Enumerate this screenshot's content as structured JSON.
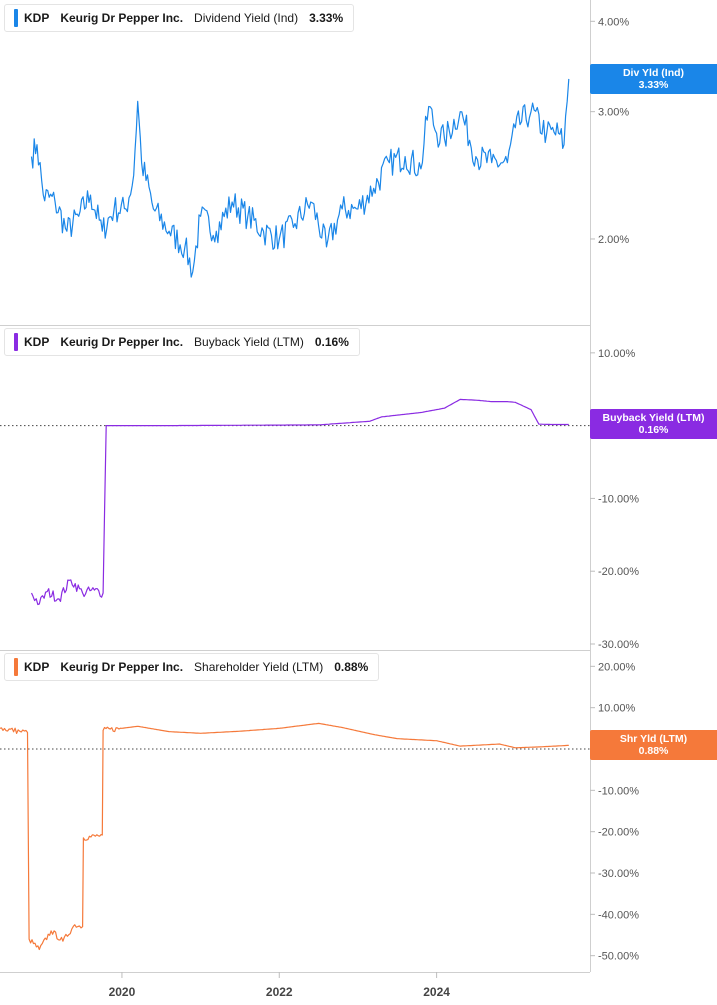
{
  "chart_data": [
    {
      "type": "line",
      "ticker": "KDP",
      "company": "Keurig Dr Pepper Inc.",
      "metric": "Dividend Yield (Ind)",
      "last_value": "3.33%",
      "tag": {
        "label": "Div Yld (Ind)",
        "value": "3.33%"
      },
      "color": "#1a86e8",
      "scale": "log",
      "ylim": [
        1.55,
        4.2
      ],
      "yticks": [
        {
          "value": 2.0,
          "label": "2.00%"
        },
        {
          "value": 3.0,
          "label": "3.00%"
        },
        {
          "value": 4.0,
          "label": "4.00%"
        }
      ],
      "series": [
        {
          "x": [
            2018.85,
            2018.92,
            2019.0,
            2019.15,
            2019.3,
            2019.45,
            2019.6,
            2019.75,
            2019.9,
            2020.05,
            2020.15,
            2020.2,
            2020.25,
            2020.4,
            2020.6,
            2020.8,
            2020.9,
            2021.0,
            2021.2,
            2021.4,
            2021.6,
            2021.8,
            2022.0,
            2022.2,
            2022.4,
            2022.6,
            2022.8,
            2023.0,
            2023.2,
            2023.4,
            2023.6,
            2023.8,
            2023.9,
            2024.0,
            2024.1,
            2024.3,
            2024.5,
            2024.7,
            2024.9,
            2025.0,
            2025.2,
            2025.4,
            2025.55,
            2025.62,
            2025.68
          ],
          "values": [
            2.6,
            2.7,
            2.3,
            2.25,
            2.05,
            2.15,
            2.3,
            2.05,
            2.2,
            2.2,
            2.45,
            3.1,
            2.55,
            2.2,
            2.05,
            1.95,
            1.8,
            2.15,
            2.05,
            2.25,
            2.15,
            2.05,
            2.0,
            2.1,
            2.25,
            1.95,
            2.2,
            2.2,
            2.35,
            2.55,
            2.6,
            2.5,
            3.05,
            2.8,
            2.75,
            3.0,
            2.6,
            2.55,
            2.55,
            2.85,
            3.0,
            2.8,
            2.8,
            2.7,
            3.33
          ]
        }
      ]
    },
    {
      "type": "line",
      "ticker": "KDP",
      "company": "Keurig Dr Pepper Inc.",
      "metric": "Buyback Yield (LTM)",
      "last_value": "0.16%",
      "tag": {
        "label": "Buyback Yield (LTM)",
        "value": "0.16%"
      },
      "color": "#8a2be2",
      "reference_line": 0,
      "ylim": [
        -30,
        13
      ],
      "yticks": [
        {
          "value": 10,
          "label": "10.00%"
        },
        {
          "value": 0,
          "label": "0.00%"
        },
        {
          "value": -10,
          "label": "-10.00%"
        },
        {
          "value": -20,
          "label": "-20.00%"
        },
        {
          "value": -30,
          "label": "-30.00%"
        }
      ],
      "series": [
        {
          "x": [
            2018.85,
            2018.95,
            2019.05,
            2019.2,
            2019.35,
            2019.5,
            2019.65,
            2019.76,
            2019.8,
            2020.5,
            2021.5,
            2022.5,
            2023.15,
            2023.3,
            2023.8,
            2024.1,
            2024.3,
            2024.5,
            2024.7,
            2024.9,
            2025.0,
            2025.2,
            2025.3,
            2025.45,
            2025.68
          ],
          "values": [
            -23.0,
            -24.5,
            -22.8,
            -23.8,
            -21.2,
            -23.0,
            -22.6,
            -23.0,
            0.0,
            0.0,
            0.05,
            0.1,
            0.6,
            1.2,
            1.8,
            2.4,
            3.6,
            3.5,
            3.3,
            3.3,
            3.2,
            2.2,
            0.2,
            0.16,
            0.16
          ]
        }
      ]
    },
    {
      "type": "line",
      "ticker": "KDP",
      "company": "Keurig Dr Pepper Inc.",
      "metric": "Shareholder Yield (LTM)",
      "last_value": "0.88%",
      "tag": {
        "label": "Shr Yld (LTM)",
        "value": "0.88%"
      },
      "color": "#f5793a",
      "reference_line": 0,
      "ylim": [
        -52.5,
        22.5
      ],
      "yticks": [
        {
          "value": 20,
          "label": "20.00%"
        },
        {
          "value": 10,
          "label": "10.00%"
        },
        {
          "value": 0,
          "label": "0.00%"
        },
        {
          "value": -10,
          "label": "-10.00%"
        },
        {
          "value": -20,
          "label": "-20.00%"
        },
        {
          "value": -30,
          "label": "-30.00%"
        },
        {
          "value": -40,
          "label": "-40.00%"
        },
        {
          "value": -50,
          "label": "-50.00%"
        }
      ],
      "series": [
        {
          "x": [
            2018.45,
            2018.7,
            2018.8,
            2018.82,
            2018.95,
            2019.1,
            2019.25,
            2019.4,
            2019.5,
            2019.51,
            2019.7,
            2019.75,
            2019.76,
            2020.0,
            2020.2,
            2020.6,
            2021.0,
            2021.5,
            2022.0,
            2022.5,
            2022.8,
            2023.2,
            2023.5,
            2024.0,
            2024.3,
            2024.8,
            2025.0,
            2025.3,
            2025.68
          ],
          "values": [
            5.0,
            4.3,
            4.0,
            -46.0,
            -48.5,
            -44.0,
            -46.5,
            -42.5,
            -43.0,
            -21.5,
            -21.0,
            -20.8,
            4.5,
            5.0,
            5.5,
            4.2,
            3.8,
            4.3,
            5.0,
            6.2,
            5.2,
            3.5,
            2.5,
            2.0,
            0.7,
            1.2,
            0.3,
            0.5,
            0.88
          ]
        }
      ]
    }
  ],
  "x_axis": {
    "ticks": [
      {
        "value": 2020,
        "label": "2020"
      },
      {
        "value": 2022,
        "label": "2022"
      },
      {
        "value": 2024,
        "label": "2024"
      }
    ],
    "range": [
      2018.45,
      2025.95
    ]
  }
}
